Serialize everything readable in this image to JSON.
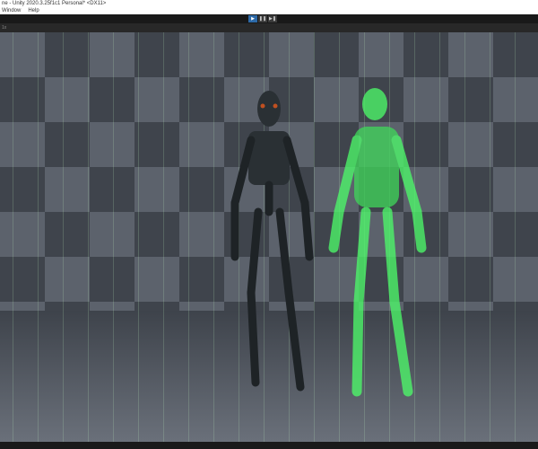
{
  "window": {
    "title": "ne - Unity 2020.3.25f1c1 Personal* <DX11>"
  },
  "menu": {
    "items": [
      "Window",
      "Help"
    ]
  },
  "toolbar": {
    "play": "▶",
    "pause": "❚❚",
    "step": "▶❚"
  },
  "game_view": {
    "scale": "1x"
  },
  "colors": {
    "accent": "#2d6aa8",
    "matrix_green": "#4dff6a"
  }
}
